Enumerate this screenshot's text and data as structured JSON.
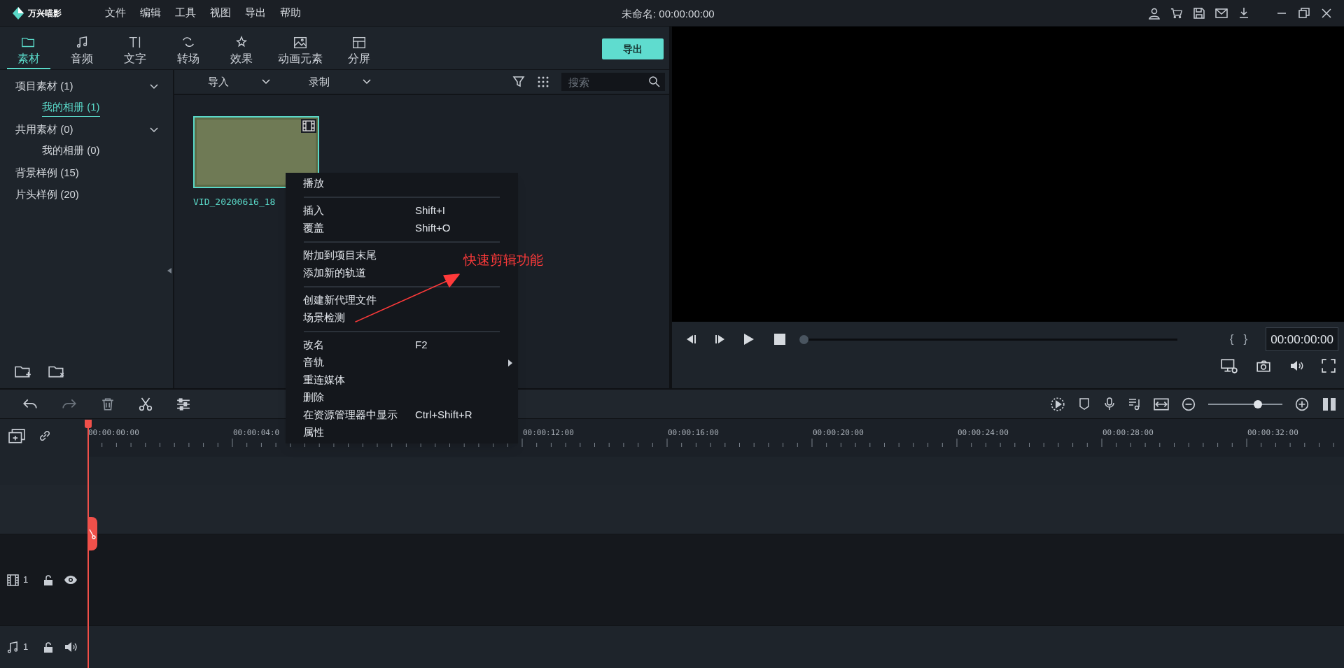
{
  "app": {
    "logo": "万兴喵影",
    "title": "未命名: 00:00:00:00"
  },
  "menu_bar": [
    "文件",
    "编辑",
    "工具",
    "视图",
    "导出",
    "帮助"
  ],
  "tabs": [
    {
      "label": "素材",
      "selected": true
    },
    {
      "label": "音频",
      "selected": false
    },
    {
      "label": "文字",
      "selected": false
    },
    {
      "label": "转场",
      "selected": false
    },
    {
      "label": "效果",
      "selected": false
    },
    {
      "label": "动画元素",
      "selected": false
    },
    {
      "label": "分屏",
      "selected": false
    }
  ],
  "export_button": "导出",
  "sidebar": {
    "items": [
      {
        "label": "项目素材 (1)",
        "expanded": true,
        "selected": false,
        "children": [
          {
            "label": "我的相册 (1)",
            "selected": true
          }
        ]
      },
      {
        "label": "共用素材 (0)",
        "expanded": true,
        "selected": false,
        "children": [
          {
            "label": "我的相册 (0)",
            "selected": false
          }
        ]
      },
      {
        "label": "背景样例 (15)",
        "selected": false
      },
      {
        "label": "片头样例 (20)",
        "selected": false
      }
    ]
  },
  "media_toolbar": {
    "dropdowns": [
      "导入",
      "录制"
    ],
    "search": {
      "placeholder": "搜索"
    }
  },
  "media_items": [
    {
      "name": "VID_20200616_18",
      "selected": true
    }
  ],
  "context_menu": {
    "groups": [
      [
        {
          "label": "播放",
          "submenu": false
        }
      ],
      [
        {
          "label": "插入",
          "shortcut": "Shift+I",
          "submenu": false
        },
        {
          "label": "覆盖",
          "shortcut": "Shift+O",
          "submenu": false
        }
      ],
      [
        {
          "label": "附加到项目末尾",
          "submenu": false
        },
        {
          "label": "添加新的轨道",
          "submenu": false
        }
      ],
      [
        {
          "label": "创建新代理文件",
          "submenu": false
        },
        {
          "label": "场景检测",
          "submenu": false
        }
      ],
      [
        {
          "label": "改名",
          "shortcut": "F2",
          "submenu": false
        },
        {
          "label": "音轨",
          "submenu": true
        },
        {
          "label": "重连媒体",
          "submenu": false
        },
        {
          "label": "删除",
          "submenu": false
        },
        {
          "label": "在资源管理器中显示",
          "shortcut": "Ctrl+Shift+R",
          "submenu": false
        },
        {
          "label": "属性",
          "submenu": false
        }
      ]
    ]
  },
  "annotation": {
    "text": "快速剪辑功能"
  },
  "preview": {
    "mark_in": "{",
    "mark_out": "}",
    "timecode": "00:00:00:00",
    "progress": {
      "level": 0
    }
  },
  "timeline": {
    "zoom": {
      "level": 0.69
    },
    "ruler": [
      "00:00:00:00",
      "00:00:04:0",
      "00:00:12:00",
      "00:00:16:00",
      "00:00:20:00",
      "00:00:24:00",
      "00:00:28:00",
      "00:00:32:00"
    ],
    "tracks": [
      {
        "kind": "video",
        "number": "1"
      },
      {
        "kind": "audio",
        "number": "1"
      }
    ]
  }
}
